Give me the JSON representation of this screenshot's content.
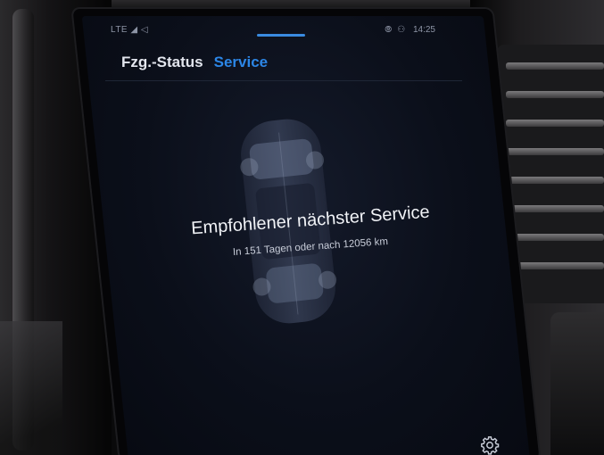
{
  "status_bar": {
    "left_text": "LTE ◢ ◁",
    "icons": [
      "link-icon",
      "person-icon"
    ],
    "time": "14:25"
  },
  "tabs": [
    {
      "label": "Fzg.-Status",
      "active": false
    },
    {
      "label": "Service",
      "active": true
    }
  ],
  "service": {
    "headline": "Empfohlener nächster Service",
    "detail": "In 151 Tagen oder nach 12056 km"
  },
  "colors": {
    "accent": "#2c86e6",
    "background": "#0b0f1a",
    "text_primary": "#f1f3f7",
    "text_secondary": "#c7ccd8"
  },
  "icons": {
    "settings": "gear-icon",
    "vehicle": "car-top-view-icon"
  }
}
